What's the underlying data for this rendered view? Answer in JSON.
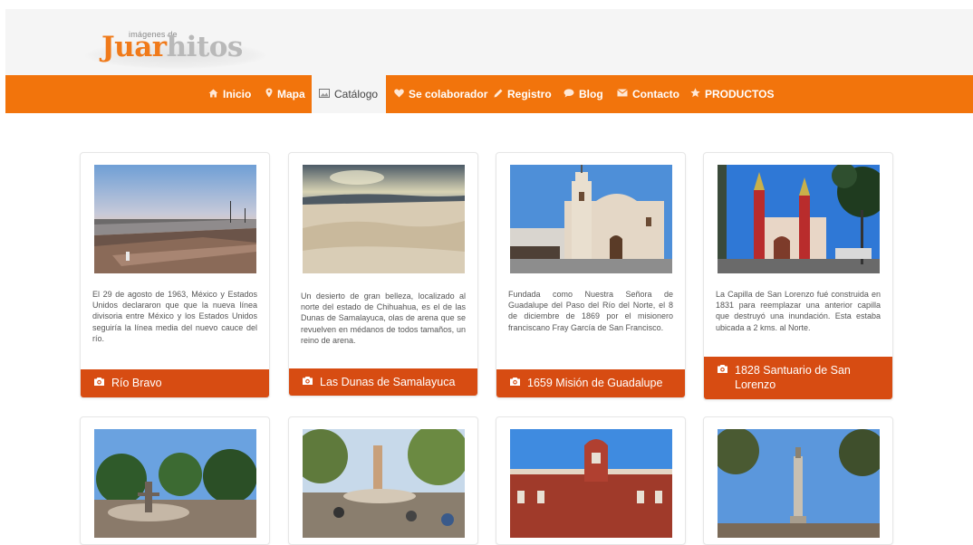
{
  "logo": {
    "small": "imágenes de",
    "word_orange": "Juar",
    "word_gray": "hitos"
  },
  "nav": [
    {
      "label": "Inicio",
      "icon": "home-icon"
    },
    {
      "label": "Mapa",
      "icon": "map-marker-icon"
    },
    {
      "label": "Catálogo",
      "icon": "picture-icon"
    },
    {
      "label": "Se colaborador",
      "icon": "heart-icon"
    },
    {
      "label": "Registro",
      "icon": "pencil-icon"
    },
    {
      "label": "Blog",
      "icon": "chat-bubble-icon"
    },
    {
      "label": "Contacto",
      "icon": "envelope-icon"
    },
    {
      "label": "PRODUCTOS",
      "icon": "star-icon"
    }
  ],
  "cards": [
    {
      "title": "Río Bravo",
      "description": "El 29 de agosto de 1963, México y Estados Unidos declararon que que la nueva línea divisoria entre México y los Estados Unidos seguiría la línea media del nuevo cauce del río."
    },
    {
      "title": "Las Dunas de Samalayuca",
      "description": "Un desierto de gran belleza, localizado al norte del estado de Chihuahua, es el de las Dunas de Samalayuca, olas de arena que se revuelven en médanos de todos tamaños, un reino de arena."
    },
    {
      "title": "1659 Misión de Guadalupe",
      "description": "Fundada como Nuestra Señora de Guadalupe del Paso del Río del Norte, el 8 de diciembre de 1869 por el misionero franciscano Fray García de San Francisco."
    },
    {
      "title": "1828 Santuario de San Lorenzo",
      "description": "La Capilla de San Lorenzo fué construida en 1831 para reemplazar una anterior capilla que destruyó una inundación. Esta estaba ubicada a 2 kms. al Norte."
    }
  ],
  "colors": {
    "nav_bg": "#f2740c",
    "title_bar": "#d74c12",
    "header_bg": "#f5f5f5"
  }
}
